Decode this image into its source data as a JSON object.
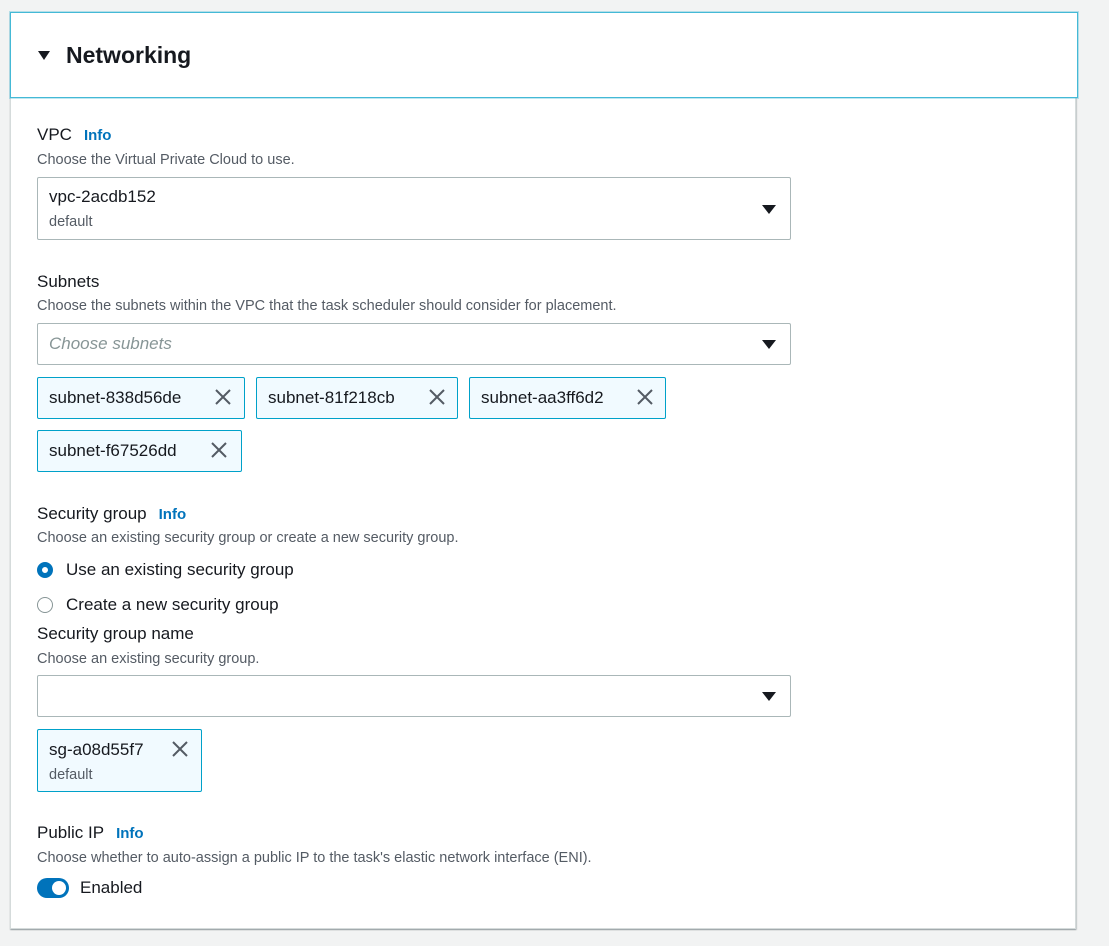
{
  "section": {
    "title": "Networking"
  },
  "vpc": {
    "label": "VPC",
    "info": "Info",
    "description": "Choose the Virtual Private Cloud to use.",
    "value": "vpc-2acdb152",
    "sub": "default"
  },
  "subnets": {
    "label": "Subnets",
    "description": "Choose the subnets within the VPC that the task scheduler should consider for placement.",
    "placeholder": "Choose subnets",
    "tokens": [
      "subnet-838d56de",
      "subnet-81f218cb",
      "subnet-aa3ff6d2",
      "subnet-f67526dd"
    ]
  },
  "security_group": {
    "label": "Security group",
    "info": "Info",
    "description": "Choose an existing security group or create a new security group.",
    "options": [
      {
        "label": "Use an existing security group",
        "selected": true
      },
      {
        "label": "Create a new security group",
        "selected": false
      }
    ],
    "name_label": "Security group name",
    "name_description": "Choose an existing security group.",
    "name_value": "",
    "token": {
      "label": "sg-a08d55f7",
      "sub": "default"
    }
  },
  "public_ip": {
    "label": "Public IP",
    "info": "Info",
    "description": "Choose whether to auto-assign a public IP to the task's elastic network interface (ENI).",
    "toggle_label": "Enabled",
    "enabled": true
  },
  "colors": {
    "accent": "#0073bb",
    "token_border": "#00a1c9",
    "token_bg": "#f1faff",
    "header_focus": "#44b9d6"
  }
}
